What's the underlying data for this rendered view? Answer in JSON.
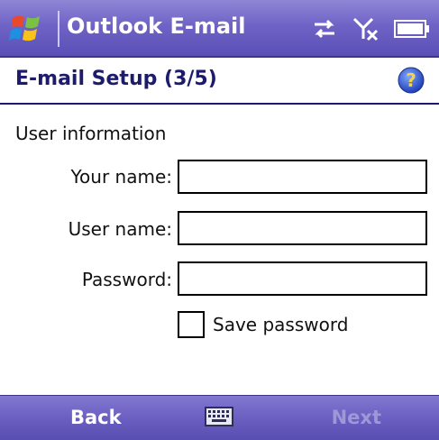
{
  "title_bar": {
    "app_title": "Outlook E-mail",
    "icons": [
      "windows-start-flag-icon",
      "sync-arrows-icon",
      "signal-off-icon",
      "battery-icon"
    ]
  },
  "header": {
    "page_title": "E-mail Setup (3/5)",
    "help_icon": "question-mark-icon"
  },
  "form": {
    "section_label": "User information",
    "fields": [
      {
        "label": "Your name:",
        "value": ""
      },
      {
        "label": "User name:",
        "value": ""
      },
      {
        "label": "Password:",
        "value": ""
      }
    ],
    "save_password": {
      "label": "Save password",
      "checked": false
    }
  },
  "softkeys": {
    "left": "Back",
    "center_icon": "keyboard-icon",
    "right": "Next",
    "right_enabled": false
  },
  "colors": {
    "title_bar": "#6f63c6",
    "header_text": "#1d1b6c",
    "softkey_disabled": "#9f98d8"
  }
}
